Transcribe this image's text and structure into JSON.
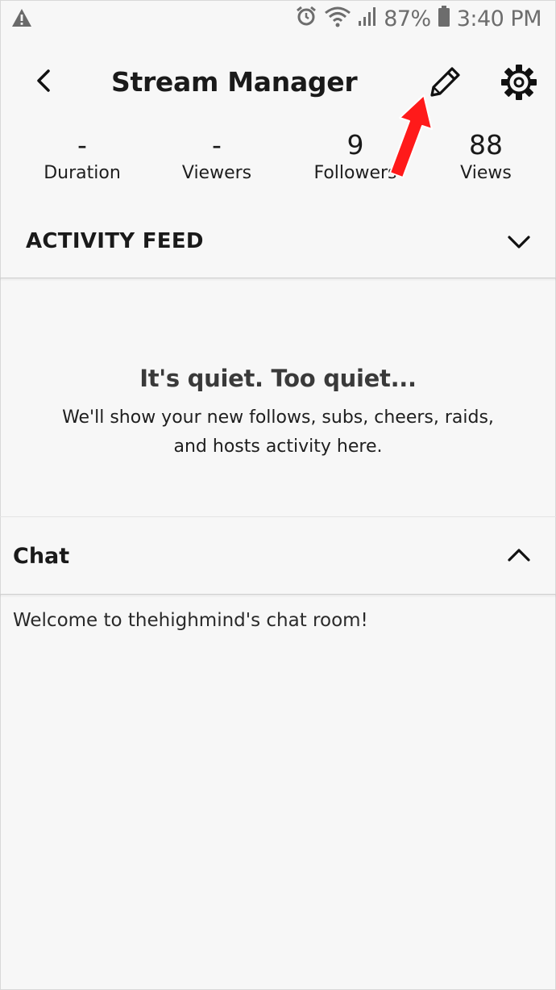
{
  "status_bar": {
    "battery_percent": "87%",
    "time": "3:40 PM",
    "icons": [
      "warning-icon",
      "alarm-icon",
      "wifi-icon",
      "signal-icon",
      "battery-icon"
    ]
  },
  "header": {
    "title": "Stream Manager",
    "icons": [
      "back-icon",
      "pencil-icon",
      "gear-icon"
    ]
  },
  "stats": [
    {
      "value": "-",
      "label": "Duration"
    },
    {
      "value": "-",
      "label": "Viewers"
    },
    {
      "value": "9",
      "label": "Followers"
    },
    {
      "value": "88",
      "label": "Views"
    }
  ],
  "annotation": {
    "color": "#ff1a1a"
  },
  "activity_feed": {
    "title": "ACTIVITY FEED",
    "empty_heading": "It's quiet. Too quiet...",
    "empty_line1": "We'll show your new follows, subs, cheers, raids,",
    "empty_line2": "and hosts activity here."
  },
  "chat": {
    "title": "Chat",
    "message": "Welcome to thehighmind's chat room!"
  }
}
